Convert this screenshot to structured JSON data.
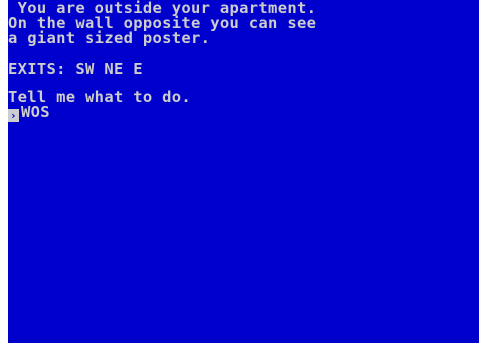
{
  "screen": {
    "bg_color": "#0000cc",
    "text_color": "#cdcdcd",
    "room_lines": [
      " You are outside your apartment.",
      "On the wall opposite you can see",
      "a giant sized poster."
    ],
    "exits": "EXITS: SW NE E",
    "prompt": "Tell me what to do.",
    "cursor_glyph": "›",
    "input": "WOS"
  }
}
